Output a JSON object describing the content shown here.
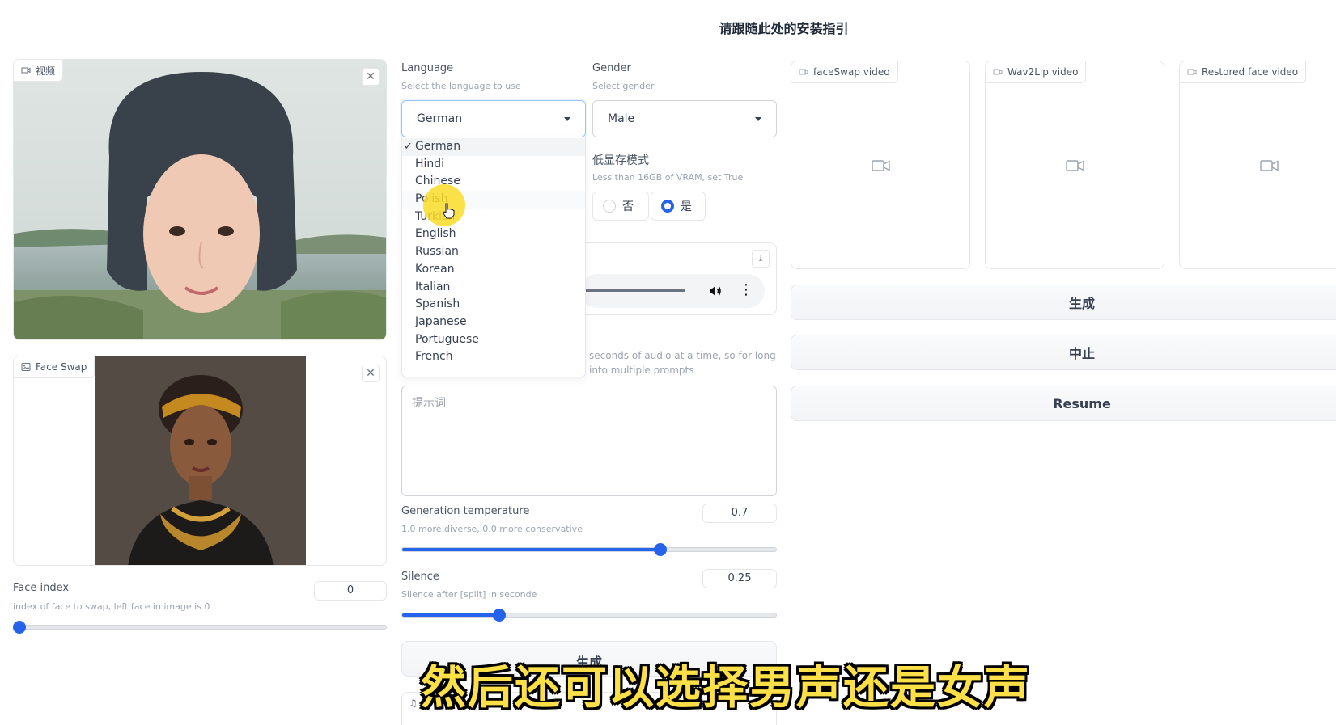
{
  "header": {
    "title": "请跟随此处的安装指引"
  },
  "video_panel": {
    "label": "视频"
  },
  "face_swap_panel": {
    "label": "Face Swap"
  },
  "face_index": {
    "label": "Face index",
    "sublabel": "index of face to swap, left face in image is 0",
    "value": "0",
    "slider_fraction": 0.0
  },
  "language": {
    "label": "Language",
    "sublabel": "Select the language to use",
    "value": "German",
    "options": [
      "German",
      "Hindi",
      "Chinese",
      "Polish",
      "Turkish",
      "English",
      "Russian",
      "Korean",
      "Italian",
      "Spanish",
      "Japanese",
      "Portuguese",
      "French"
    ],
    "check": "✓"
  },
  "gender": {
    "label": "Gender",
    "sublabel": "Select gender",
    "value": "Male"
  },
  "low_vram": {
    "label": "低显存模式",
    "sublabel": "Less than 16GB of VRAM, set True",
    "option_no": "否",
    "option_yes": "是"
  },
  "audio_hint": {
    "line1": "seconds of audio at a time, so for long",
    "line2": "into multiple prompts"
  },
  "prompt": {
    "placeholder": "提示词"
  },
  "temperature": {
    "label": "Generation temperature",
    "sublabel": "1.0 more diverse, 0.0 more conservative",
    "value": "0.7",
    "slider_fraction": 0.69
  },
  "silence": {
    "label": "Silence",
    "sublabel": "Silence after [split] in seconde",
    "value": "0.25",
    "slider_fraction": 0.26
  },
  "left_generate": {
    "label": "生成"
  },
  "output_panels": {
    "faceswap": "faceSwap video",
    "wav2lip": "Wav2Lip video",
    "restored": "Restored face video"
  },
  "buttons": {
    "generate": "生成",
    "stop": "中止",
    "resume": "Resume"
  },
  "caption": {
    "text": "然后还可以选择男声还是女声"
  },
  "colors": {
    "accent": "#2563eb",
    "caption": "#fde047"
  }
}
